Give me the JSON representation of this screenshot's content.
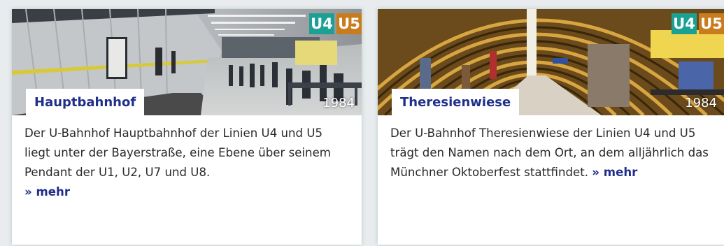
{
  "cards": [
    {
      "station": "Hauptbahnhof",
      "year": "1984",
      "lines": [
        "U4",
        "U5"
      ],
      "description": "Der U-Bahnhof Hauptbahnhof der Linien U4 und U5 liegt unter der Bayerstraße, eine Ebene über seinem Pendant der U1, U2, U7 und U8.",
      "more_label": "» mehr"
    },
    {
      "station": "Theresienwiese",
      "year": "1984",
      "lines": [
        "U4",
        "U5"
      ],
      "description": "Der U-Bahnhof Theresienwiese der Linien U4 und U5 trägt den Namen nach dem Ort, an dem alljährlich das Münchner Oktoberfest stattfindet.",
      "more_label": "» mehr"
    }
  ],
  "colors": {
    "u4": "#1ba193",
    "u5": "#c97c1d",
    "link": "#1f2f8a"
  }
}
